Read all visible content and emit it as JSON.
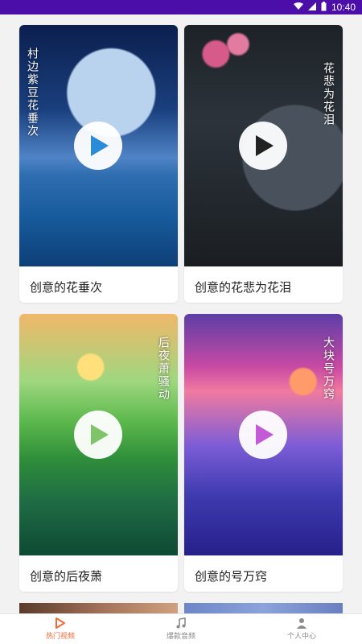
{
  "status_bar": {
    "time": "10:40"
  },
  "cards": [
    {
      "caption": "创意的花垂次",
      "overlay_text": "村边紫豆花垂次"
    },
    {
      "caption": "创意的花悲为花泪",
      "overlay_text": "花悲为花泪"
    },
    {
      "caption": "创意的后夜萧",
      "overlay_text": "后夜萧骚动"
    },
    {
      "caption": "创意的号万窍",
      "overlay_text": "大块号万窍"
    }
  ],
  "bottom_nav": {
    "items": [
      {
        "label": "热门视频",
        "icon": "play-icon",
        "active": true
      },
      {
        "label": "爆款音频",
        "icon": "music-note-icon",
        "active": false
      },
      {
        "label": "个人中心",
        "icon": "user-icon",
        "active": false
      }
    ]
  },
  "colors": {
    "status_bar": "#4b0ea8",
    "accent": "#f06a3a",
    "card_bg": "#ffffff",
    "page_bg": "#f2f2f2"
  }
}
